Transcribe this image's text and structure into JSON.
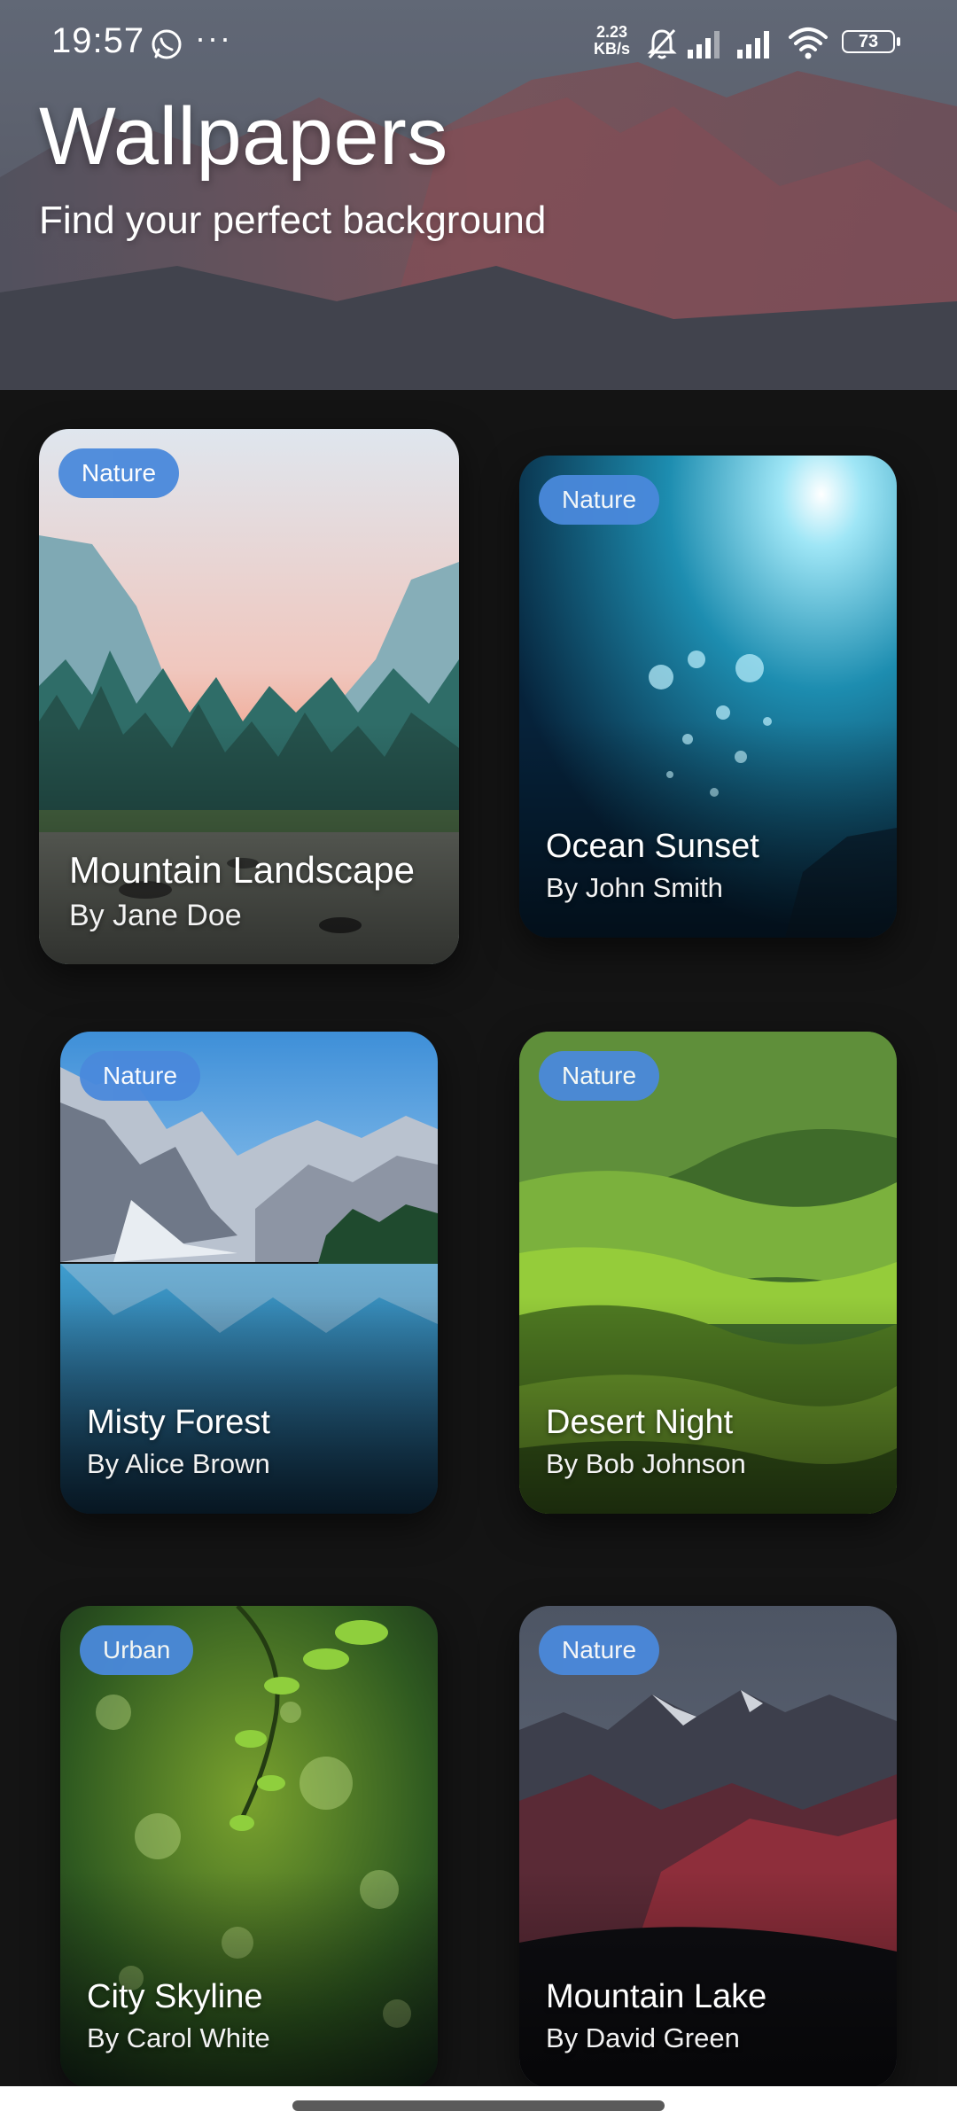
{
  "status_bar": {
    "time": "19:57",
    "more": "···",
    "speed_value": "2.23",
    "speed_unit": "KB/s",
    "battery": "73",
    "icons": [
      "whatsapp-icon",
      "bell-off-icon",
      "signal-icon",
      "signal-icon",
      "wifi-icon",
      "battery-icon"
    ]
  },
  "header": {
    "title": "Wallpapers",
    "subtitle": "Find your perfect background"
  },
  "wallpapers": [
    {
      "category": "Nature",
      "title": "Mountain Landscape",
      "author": "By Jane Doe"
    },
    {
      "category": "Nature",
      "title": "Ocean Sunset",
      "author": "By John Smith"
    },
    {
      "category": "Nature",
      "title": "Misty Forest",
      "author": "By Alice Brown"
    },
    {
      "category": "Nature",
      "title": "Desert Night",
      "author": "By Bob Johnson"
    },
    {
      "category": "Urban",
      "title": "City Skyline",
      "author": "By Carol White"
    },
    {
      "category": "Nature",
      "title": "Mountain Lake",
      "author": "By David Green"
    }
  ],
  "colors": {
    "background": "#141414",
    "badge": "#4a89dc"
  }
}
